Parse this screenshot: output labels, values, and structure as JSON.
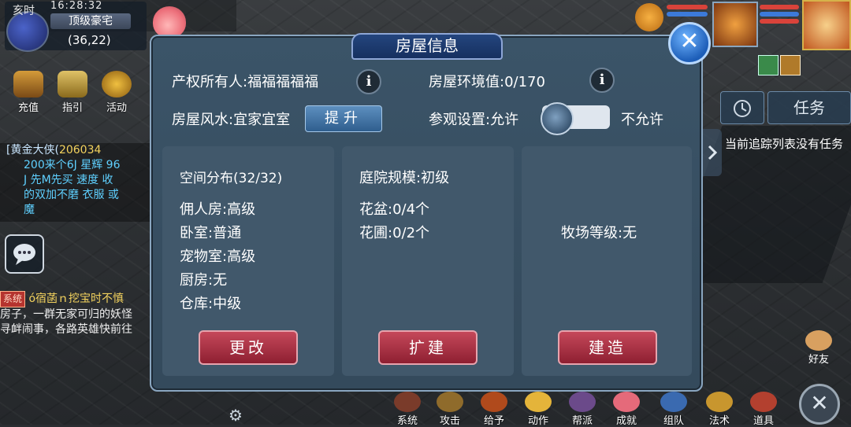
{
  "hud": {
    "time_label": "亥时",
    "clock": "16:28:32",
    "place": "顶级豪宅",
    "coords": "(36,22)"
  },
  "top_buttons": [
    {
      "label": "充值",
      "icon": "treasure-chest-icon"
    },
    {
      "label": "指引",
      "icon": "scroll-help-icon"
    },
    {
      "label": "活动",
      "icon": "gong-icon"
    }
  ],
  "chat": {
    "line1_name": "[黄金大侠(",
    "line1_num": "206034",
    "line2": "200来个6J 星辉  96",
    "line3": "J 先M先买 速度 收",
    "line4": "的双加不磨  衣服 或",
    "line5": "魔"
  },
  "system_msg": {
    "tag": "系统",
    "line1": "ó宿菡ｎ挖宝时不慎",
    "line2": "房子，一群无家可归的妖怪",
    "line3": "寻衅闹事，各路英雄快前往"
  },
  "task": {
    "tab_label": "任务",
    "empty_text": "当前追踪列表没有任务"
  },
  "dialog": {
    "title": "房屋信息",
    "owner_label": "产权所有人:福福福福福",
    "env_label": "房屋环境值:0/170",
    "fengshui_label": "房屋风水:宜家宜室",
    "upgrade_btn": "提升",
    "visit_label": "参观设置:允许",
    "visit_off_label": "不允许",
    "panels": {
      "space": {
        "title": "空间分布(32/32)",
        "rows": [
          "佣人房:高级",
          "卧室:普通",
          "宠物室:高级",
          "厨房:无",
          "仓库:中级"
        ],
        "button": "更改"
      },
      "yard": {
        "title": "庭院规模:初级",
        "rows": [
          "花盆:0/4个",
          "花圃:0/2个"
        ],
        "button": "扩建"
      },
      "ranch": {
        "title": "牧场等级:无",
        "button": "建造"
      }
    }
  },
  "bottom_bar": [
    {
      "label": "系统",
      "color": "#7a3b2a"
    },
    {
      "label": "攻击",
      "color": "#8f6b2b"
    },
    {
      "label": "给予",
      "color": "#b04a1c"
    },
    {
      "label": "动作",
      "color": "#e4b43a"
    },
    {
      "label": "帮派",
      "color": "#6b4a8a"
    },
    {
      "label": "成就",
      "color": "#e56a7a"
    },
    {
      "label": "组队",
      "color": "#3a6ab0"
    },
    {
      "label": "法术",
      "color": "#c8962e"
    },
    {
      "label": "道具",
      "color": "#b3402f"
    }
  ],
  "friends": {
    "label": "好友"
  }
}
